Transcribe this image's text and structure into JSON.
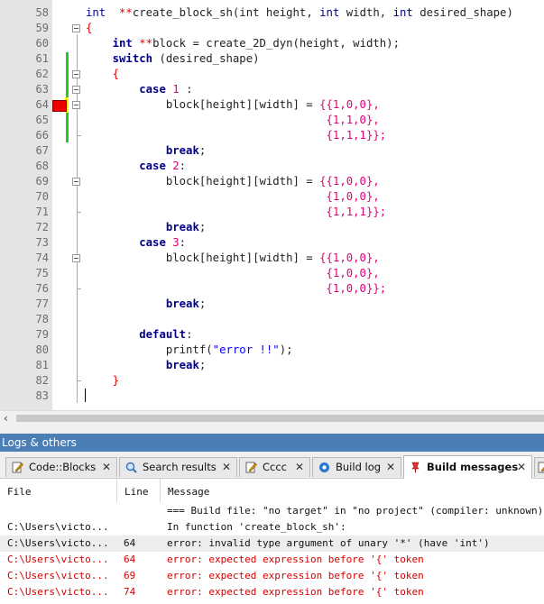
{
  "editor": {
    "lines": [
      {
        "n": "58",
        "tokens": [
          [
            "ty",
            "int"
          ],
          [
            "",
            "  "
          ],
          [
            "op",
            "**"
          ],
          [
            "",
            "create_block_sh(int height, "
          ],
          [
            "ty",
            "int"
          ],
          [
            "",
            " width, "
          ],
          [
            "ty",
            "int"
          ],
          [
            "",
            " desired_shape)"
          ]
        ]
      },
      {
        "n": "59",
        "tokens": [
          [
            "brace",
            "{"
          ]
        ]
      },
      {
        "n": "60",
        "tokens": [
          [
            "",
            "    "
          ],
          [
            "kw",
            "int"
          ],
          [
            "",
            " "
          ],
          [
            "op",
            "**"
          ],
          [
            "",
            "block = create_2D_dyn(height, width);"
          ]
        ]
      },
      {
        "n": "61",
        "tokens": [
          [
            "",
            "    "
          ],
          [
            "kw",
            "switch"
          ],
          [
            "",
            " (desired_shape)"
          ]
        ]
      },
      {
        "n": "62",
        "tokens": [
          [
            "",
            "    "
          ],
          [
            "brace",
            "{"
          ]
        ]
      },
      {
        "n": "63",
        "tokens": [
          [
            "",
            "        "
          ],
          [
            "kw",
            "case"
          ],
          [
            "",
            " "
          ],
          [
            "num",
            "1"
          ],
          [
            "",
            " :"
          ]
        ]
      },
      {
        "n": "64",
        "tokens": [
          [
            "",
            "            block[height][width] = "
          ],
          [
            "num",
            "{{1,0,0},"
          ]
        ]
      },
      {
        "n": "65",
        "tokens": [
          [
            "",
            "                                    "
          ],
          [
            "num",
            "{1,1,0},"
          ]
        ]
      },
      {
        "n": "66",
        "tokens": [
          [
            "",
            "                                    "
          ],
          [
            "num",
            "{1,1,1}};"
          ]
        ]
      },
      {
        "n": "67",
        "tokens": [
          [
            "",
            "            "
          ],
          [
            "kw",
            "break"
          ],
          [
            "",
            ";"
          ]
        ]
      },
      {
        "n": "68",
        "tokens": [
          [
            "",
            "        "
          ],
          [
            "kw",
            "case"
          ],
          [
            "",
            " "
          ],
          [
            "num",
            "2"
          ],
          [
            "",
            ":"
          ]
        ]
      },
      {
        "n": "69",
        "tokens": [
          [
            "",
            "            block[height][width] = "
          ],
          [
            "num",
            "{{1,0,0},"
          ]
        ]
      },
      {
        "n": "70",
        "tokens": [
          [
            "",
            "                                    "
          ],
          [
            "num",
            "{1,0,0},"
          ]
        ]
      },
      {
        "n": "71",
        "tokens": [
          [
            "",
            "                                    "
          ],
          [
            "num",
            "{1,1,1}};"
          ]
        ]
      },
      {
        "n": "72",
        "tokens": [
          [
            "",
            "            "
          ],
          [
            "kw",
            "break"
          ],
          [
            "",
            ";"
          ]
        ]
      },
      {
        "n": "73",
        "tokens": [
          [
            "",
            "        "
          ],
          [
            "kw",
            "case"
          ],
          [
            "",
            " "
          ],
          [
            "num",
            "3"
          ],
          [
            "",
            ":"
          ]
        ]
      },
      {
        "n": "74",
        "tokens": [
          [
            "",
            "            block[height][width] = "
          ],
          [
            "num",
            "{{1,0,0},"
          ]
        ]
      },
      {
        "n": "75",
        "tokens": [
          [
            "",
            "                                    "
          ],
          [
            "num",
            "{1,0,0},"
          ]
        ]
      },
      {
        "n": "76",
        "tokens": [
          [
            "",
            "                                    "
          ],
          [
            "num",
            "{1,0,0}};"
          ]
        ]
      },
      {
        "n": "77",
        "tokens": [
          [
            "",
            "            "
          ],
          [
            "kw",
            "break"
          ],
          [
            "",
            ";"
          ]
        ]
      },
      {
        "n": "78",
        "tokens": []
      },
      {
        "n": "79",
        "tokens": [
          [
            "",
            "        "
          ],
          [
            "kw",
            "default"
          ],
          [
            "",
            ":"
          ]
        ]
      },
      {
        "n": "80",
        "tokens": [
          [
            "",
            "            printf("
          ],
          [
            "str",
            "\"error !!\""
          ],
          [
            "",
            ");"
          ]
        ]
      },
      {
        "n": "81",
        "tokens": [
          [
            "",
            "            "
          ],
          [
            "kw",
            "break"
          ],
          [
            "",
            ";"
          ]
        ]
      },
      {
        "n": "82",
        "tokens": [
          [
            "",
            "    "
          ],
          [
            "brace",
            "}"
          ]
        ]
      },
      {
        "n": "83",
        "tokens": []
      }
    ],
    "colors": {
      "keyword": "#00008b",
      "number": "#e1007a",
      "string": "#0000ff",
      "error_marker": "#ee0000",
      "changed_bar": "#22cc22"
    }
  },
  "panel": {
    "title": "Logs & others",
    "tabs": [
      {
        "label": "Code::Blocks",
        "icon": "edit-icon",
        "close": "✕"
      },
      {
        "label": "Search results",
        "icon": "search-icon",
        "close": "✕"
      },
      {
        "label": "Cccc",
        "icon": "edit-icon",
        "close": "✕"
      },
      {
        "label": "Build log",
        "icon": "gear-icon",
        "close": "✕"
      },
      {
        "label": "Build messages",
        "icon": "pin-icon",
        "close": "✕"
      }
    ],
    "columns": {
      "file": "File",
      "line": "Line",
      "message": "Message"
    },
    "rows": [
      {
        "file": "",
        "line": "",
        "message": "=== Build file: \"no target\" in \"no project\" (compiler: unknown) ===",
        "color": "black"
      },
      {
        "file": "C:\\Users\\victo...",
        "line": "",
        "message": "In function 'create_block_sh':",
        "color": "black"
      },
      {
        "file": "C:\\Users\\victo...",
        "line": "64",
        "message": "error: invalid type argument of unary '*' (have 'int')",
        "color": "black"
      },
      {
        "file": "C:\\Users\\victo...",
        "line": "64",
        "message": "error: expected expression before '{' token",
        "color": "red"
      },
      {
        "file": "C:\\Users\\victo...",
        "line": "69",
        "message": "error: expected expression before '{' token",
        "color": "red"
      },
      {
        "file": "C:\\Users\\victo...",
        "line": "74",
        "message": "error: expected expression before '{' token",
        "color": "red"
      }
    ]
  },
  "scroll": {
    "left_arrow": "‹"
  }
}
